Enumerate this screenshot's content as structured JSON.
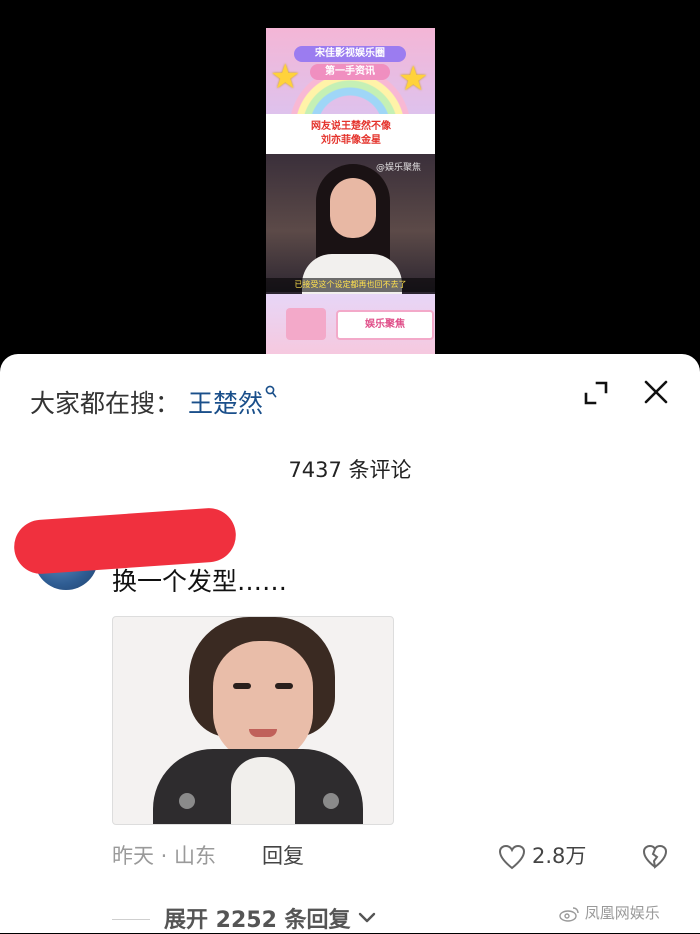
{
  "video": {
    "banner_line1": "宋佳影视娱乐圈",
    "banner_line2": "第一手资讯",
    "headline_line1": "网友说王楚然不像",
    "headline_line2": "刘亦菲像金星",
    "logo_text": "@娱乐聚焦",
    "caption": "已接受这个设定都再也回不去了",
    "tag": "娱乐聚焦"
  },
  "search": {
    "prefix": "大家都在搜：",
    "term": "王楚然"
  },
  "comments": {
    "count_label": "7437 条评论",
    "first": {
      "text": "换一个发型……",
      "time_location": "昨天 · 山东",
      "reply_label": "回复",
      "like_count": "2.8万",
      "expand_label": "展开 2252 条回复"
    }
  },
  "watermark": {
    "text": "凤凰网娱乐"
  },
  "colors": {
    "search_term": "#1a4f8a",
    "redaction": "#f0303e"
  }
}
